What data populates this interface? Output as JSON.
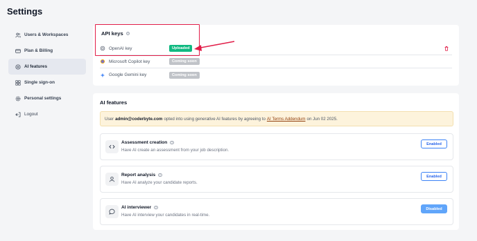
{
  "page": {
    "title": "Settings"
  },
  "sidebar": {
    "items": [
      {
        "label": "Users & Workspaces",
        "icon": "users-icon"
      },
      {
        "label": "Plan & Billing",
        "icon": "credit-card-icon"
      },
      {
        "label": "AI features",
        "icon": "ai-icon",
        "active": true
      },
      {
        "label": "Single sign-on",
        "icon": "grid-icon"
      },
      {
        "label": "Personal settings",
        "icon": "gear-icon"
      },
      {
        "label": "Logout",
        "icon": "logout-icon"
      }
    ]
  },
  "api_keys": {
    "title": "API keys",
    "rows": [
      {
        "name": "OpenAI key",
        "status": "Uploaded",
        "icon": "openai-icon"
      },
      {
        "name": "Microsoft Copilot key",
        "status": "Coming soon",
        "icon": "copilot-icon"
      },
      {
        "name": "Google Gemini key",
        "status": "Coming soon",
        "icon": "gemini-icon"
      }
    ]
  },
  "ai_features": {
    "title": "AI features",
    "notice": {
      "prefix": "User",
      "email": "admin@coderbyte.com",
      "middle": "opted into using generative AI features by agreeing to",
      "link": "AI Terms Addendum",
      "suffix": "on Jun 02 2025."
    },
    "features": [
      {
        "title": "Assessment creation",
        "description": "Have AI create an assessment from your job description.",
        "button": "Enabled",
        "icon": "code-icon"
      },
      {
        "title": "Report analysis",
        "description": "Have AI analyze your candidate reports.",
        "button": "Enabled",
        "icon": "user-icon"
      },
      {
        "title": "AI interviewer",
        "description": "Have AI interview your candidates in real-time.",
        "button": "Disabled",
        "icon": "chat-bubble-icon"
      }
    ]
  },
  "colors": {
    "accent": "#3b82f6",
    "uploaded": "#10b981",
    "highlight": "#e11d48",
    "notice_bg": "#fdf3dc"
  }
}
